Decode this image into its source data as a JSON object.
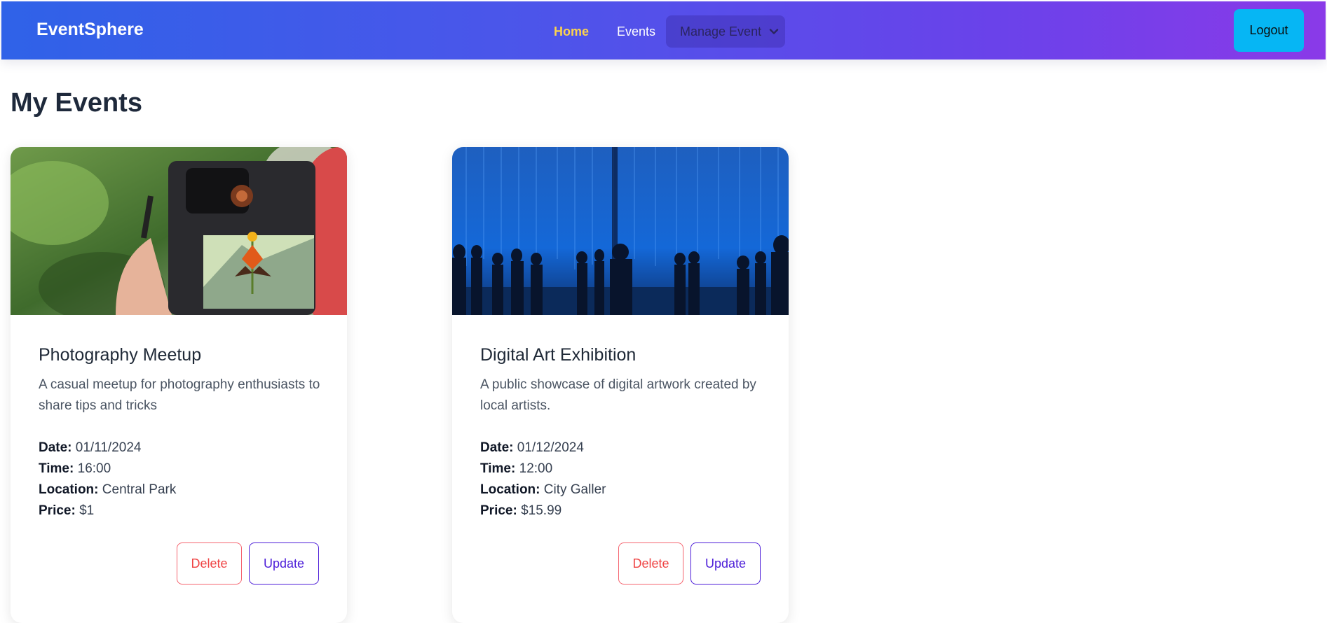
{
  "navbar": {
    "brand": "EventSphere",
    "links": {
      "home": "Home",
      "events": "Events"
    },
    "manage_event": {
      "label": "Manage Event",
      "icon": "chevron-down-icon"
    },
    "logout_label": "Logout",
    "colors": {
      "gradient_start": "#2f62e8",
      "gradient_end": "#8a3ae8",
      "active_link": "#fcd34d",
      "logout_bg": "#06b6f4"
    }
  },
  "page": {
    "title": "My Events"
  },
  "events": [
    {
      "title": "Photography Meetup",
      "description": "A casual meetup for photography enthusiasts to share tips and tricks",
      "date_label": "Date:",
      "date": "01/11/2024",
      "time_label": "Time:",
      "time": "16:00",
      "location_label": "Location:",
      "location": "Central Park",
      "price_label": "Price:",
      "price": "$1",
      "delete_label": "Delete",
      "update_label": "Update"
    },
    {
      "title": "Digital Art Exhibition",
      "description": "A public showcase of digital artwork created by local artists.",
      "date_label": "Date:",
      "date": "01/12/2024",
      "time_label": "Time:",
      "time": "12:00",
      "location_label": "Location:",
      "location": "City Galler",
      "price_label": "Price:",
      "price": "$15.99",
      "delete_label": "Delete",
      "update_label": "Update"
    }
  ]
}
